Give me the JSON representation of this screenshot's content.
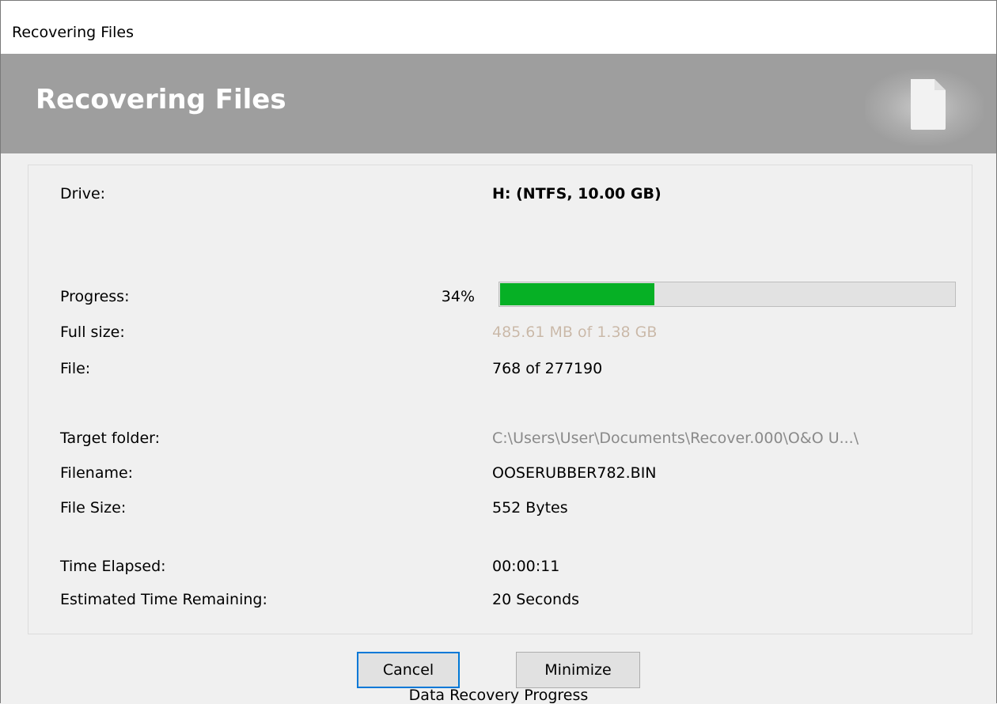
{
  "window": {
    "title": "Recovering Files"
  },
  "banner": {
    "title": "Recovering Files",
    "icon": "document-icon"
  },
  "fields": {
    "drive": {
      "label": "Drive:",
      "value": "H: (NTFS, 10.00 GB)"
    },
    "progress": {
      "label": "Progress:",
      "percent_text": "34%",
      "percent": 34
    },
    "full_size": {
      "label": "Full size:",
      "value": "485.61 MB of 1.38 GB"
    },
    "file": {
      "label": "File:",
      "value": "768 of 277190"
    },
    "target_folder": {
      "label": "Target folder:",
      "value": "C:\\Users\\User\\Documents\\Recover.000\\O&O U...\\"
    },
    "filename": {
      "label": "Filename:",
      "value": "OOSERUBBER782.BIN"
    },
    "file_size": {
      "label": "File Size:",
      "value": "552 Bytes"
    },
    "time_elapsed": {
      "label": "Time Elapsed:",
      "value": "00:00:11"
    },
    "time_remaining": {
      "label": "Estimated Time Remaining:",
      "value": "20 Seconds"
    }
  },
  "buttons": {
    "cancel": "Cancel",
    "minimize": "Minimize"
  },
  "caption": "Data Recovery Progress",
  "colors": {
    "banner": "#9e9e9e",
    "progress_fill": "#06b025",
    "focus_border": "#0078d7"
  }
}
